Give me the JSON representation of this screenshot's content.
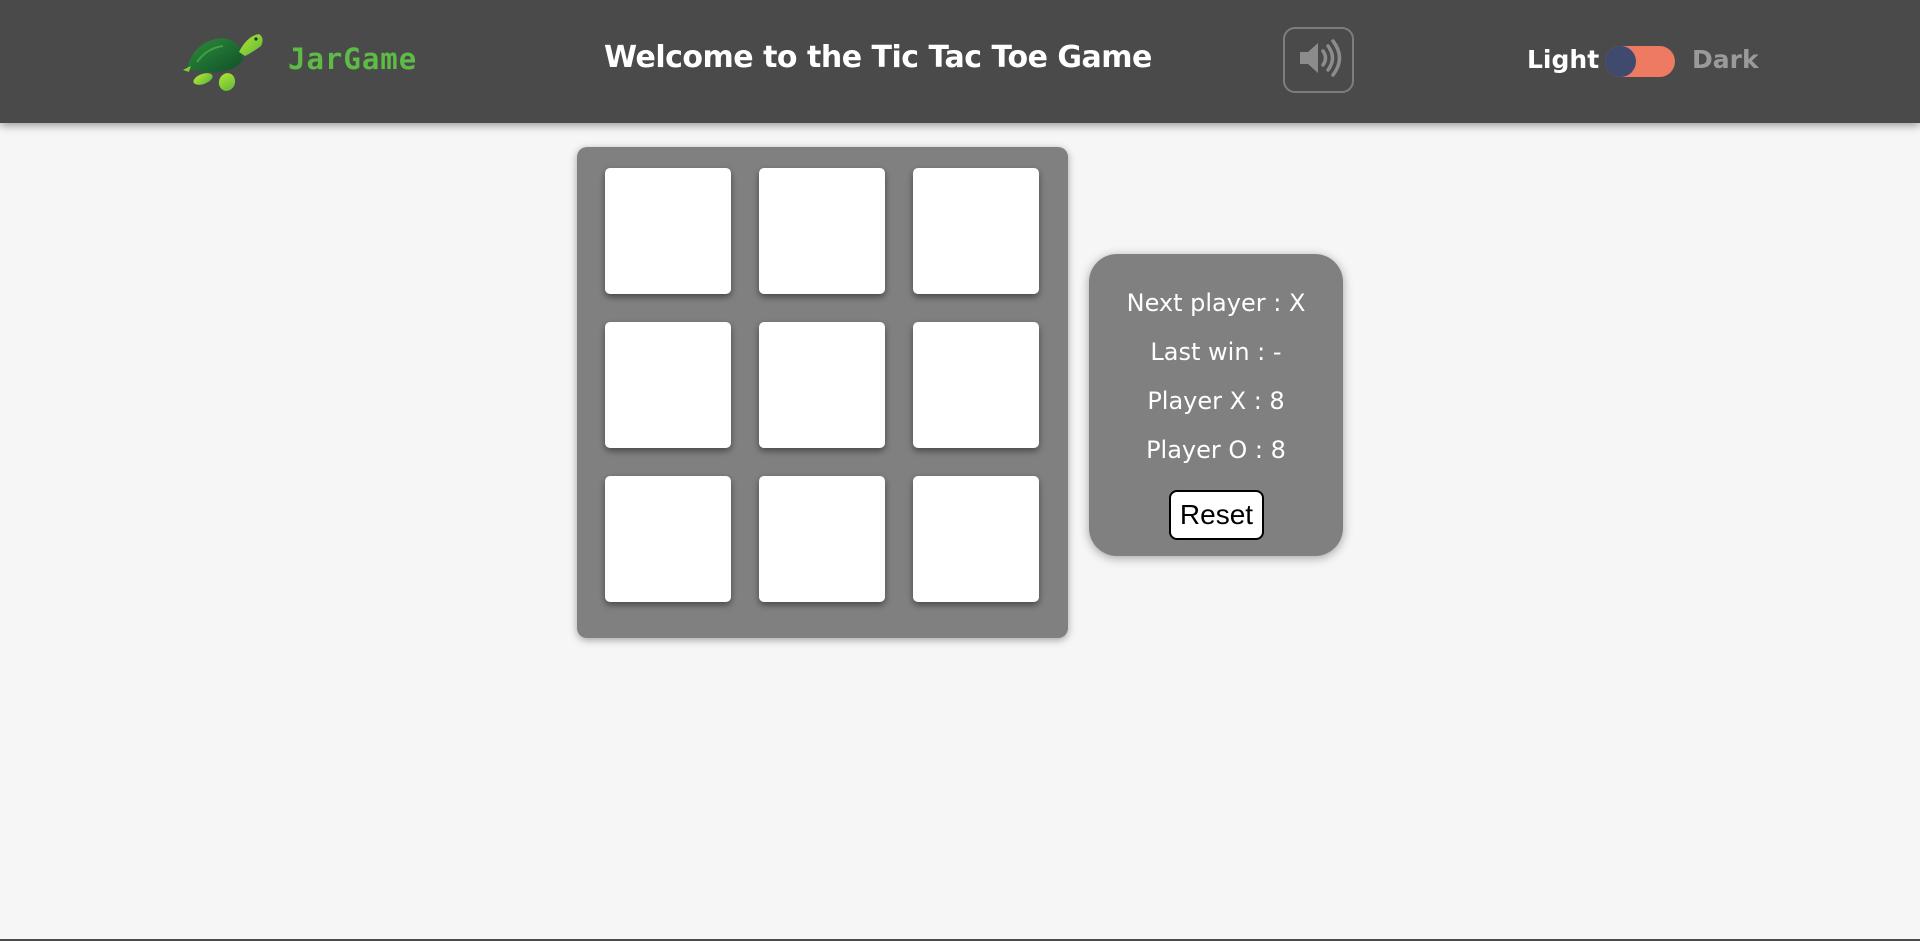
{
  "header": {
    "brand": "JarGame",
    "title": "Welcome to the Tic Tac Toe Game",
    "sound_icon": "speaker-volume-icon",
    "theme_light_label": "Light",
    "theme_dark_label": "Dark"
  },
  "board": {
    "cells": [
      "",
      "",
      "",
      "",
      "",
      "",
      "",
      "",
      ""
    ]
  },
  "info": {
    "next_player": "Next player : X",
    "last_win": "Last win : -",
    "player_x": "Player X : 8",
    "player_o": "Player O : 8",
    "reset_label": "Reset"
  },
  "colors": {
    "header_bg": "#4a4a4a",
    "brand": "#5dbb46",
    "panel_bg": "#808080",
    "toggle_track": "#ef7a62",
    "toggle_knob": "#3f4a6e",
    "page_bg": "#f6f6f6"
  }
}
